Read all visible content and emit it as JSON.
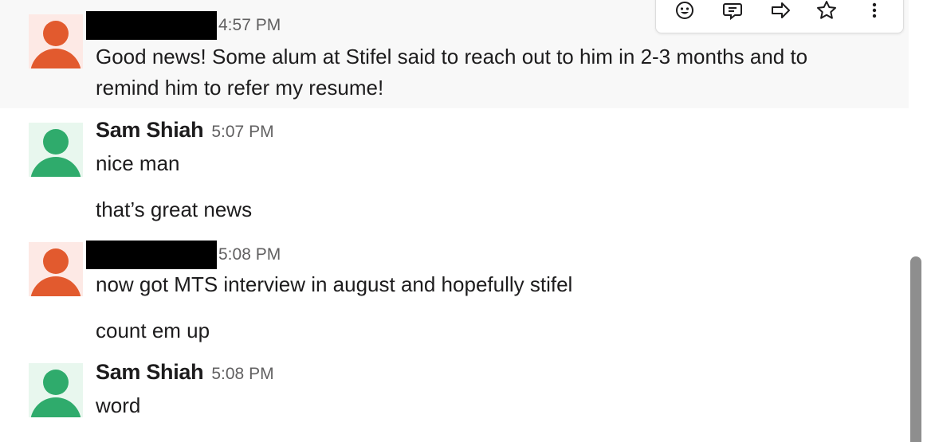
{
  "messages": [
    {
      "sender": "",
      "sender_redacted": true,
      "time": "4:57 PM",
      "lines": [
        "Good news! Some alum at Stifel said to reach out to him in 2-3 months and to",
        "remind him to refer my resume!"
      ]
    },
    {
      "sender": "Sam Shiah",
      "sender_redacted": false,
      "time": "5:07 PM",
      "lines": [
        "nice man",
        "that’s great news"
      ]
    },
    {
      "sender": "",
      "sender_redacted": true,
      "time": "5:08 PM",
      "lines": [
        "now got MTS interview in august and hopefully stifel",
        "count em up"
      ]
    },
    {
      "sender": "Sam Shiah",
      "sender_redacted": false,
      "time": "5:08 PM",
      "lines": [
        "word"
      ]
    }
  ],
  "toolbar": {
    "icons": [
      "emoji-reaction-icon",
      "reply-thread-icon",
      "share-icon",
      "save-star-icon",
      "more-actions-icon"
    ]
  },
  "colors": {
    "avatar_orange": "#e25a2e",
    "avatar_green": "#2fab6c",
    "hover_background": "#f8f8f8",
    "timestamp": "#616061"
  }
}
